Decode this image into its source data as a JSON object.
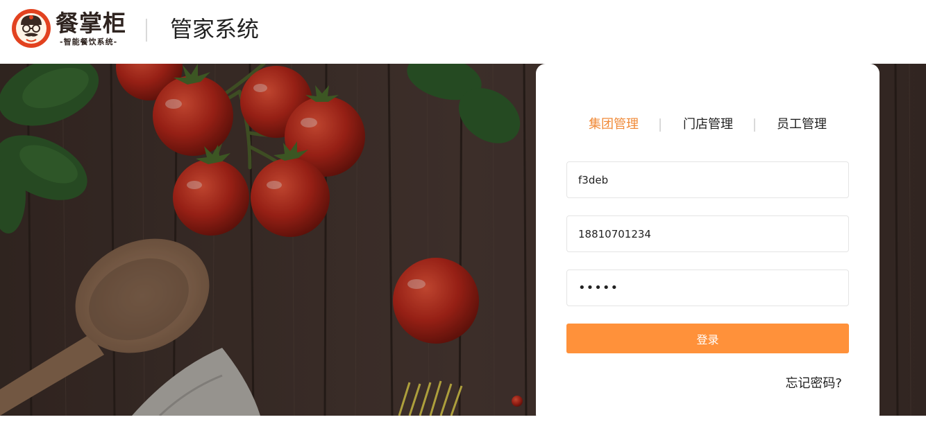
{
  "header": {
    "logo_text": "餐掌柜",
    "logo_slogan": "-智能餐饮系统-",
    "system_title": "管家系统"
  },
  "login": {
    "tabs": [
      {
        "label": "集团管理",
        "active": true
      },
      {
        "label": "门店管理",
        "active": false
      },
      {
        "label": "员工管理",
        "active": false
      }
    ],
    "fields": {
      "code_value": "f3deb",
      "phone_value": "18810701234",
      "password_value": "12345"
    },
    "submit_label": "登录",
    "forgot_label": "忘记密码?"
  },
  "colors": {
    "accent": "#ff913a",
    "active_tab": "#f08a38",
    "logo_red": "#e2421f"
  }
}
